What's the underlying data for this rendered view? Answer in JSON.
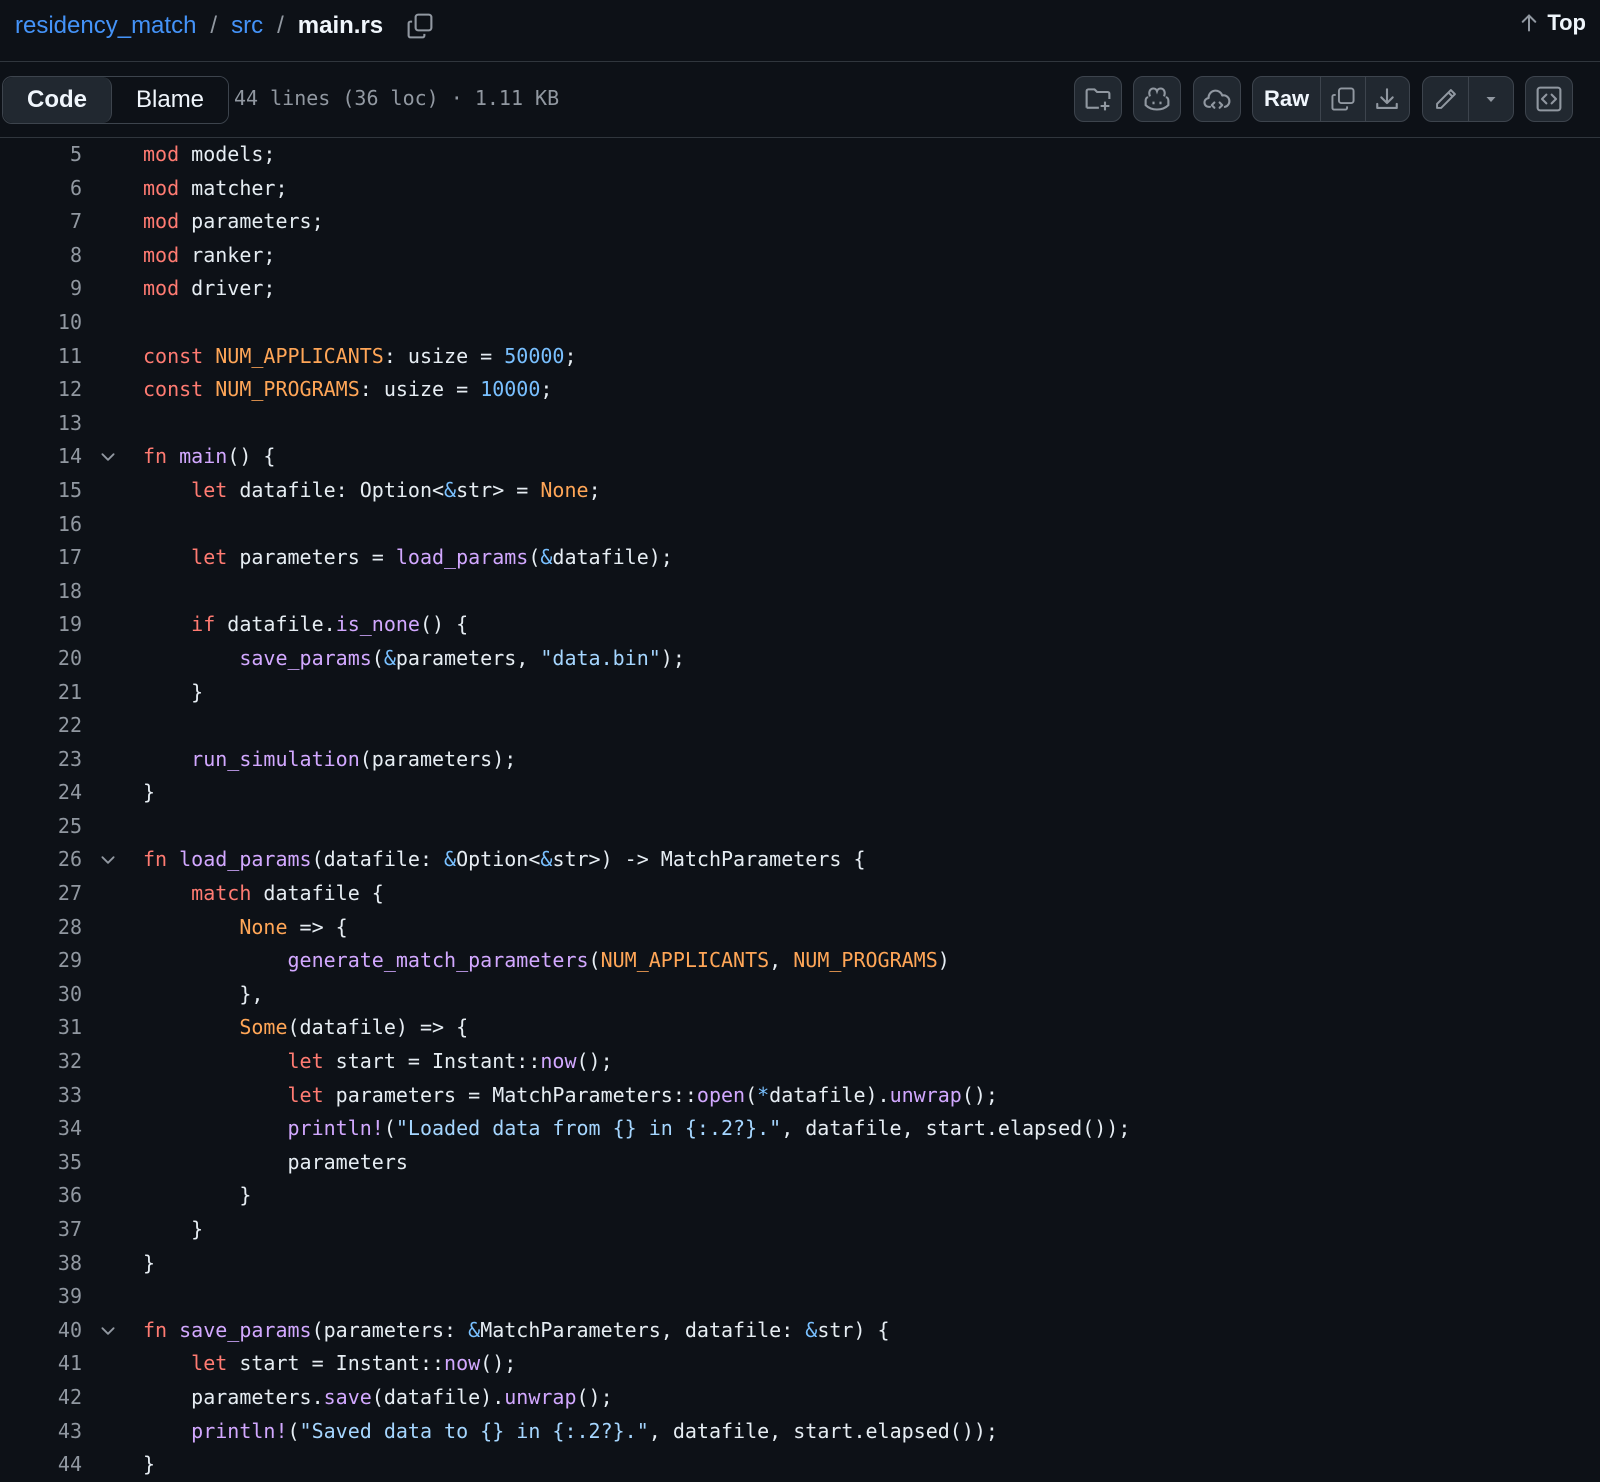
{
  "breadcrumb": {
    "repo": "residency_match",
    "sep1": "/",
    "dir": "src",
    "sep2": "/",
    "file": "main.rs"
  },
  "top_link": "Top",
  "view_tabs": {
    "code": "Code",
    "blame": "Blame"
  },
  "file_info": "44 lines (36 loc) · 1.11 KB",
  "toolbar": {
    "raw_label": "Raw"
  },
  "icons": [
    "copy-path-icon",
    "arrow-up-icon",
    "folder-plus-icon",
    "copilot-icon",
    "codespace-icon",
    "copy-icon",
    "download-icon",
    "pencil-icon",
    "caret-down-icon",
    "symbols-panel-icon",
    "chevron-down-icon"
  ],
  "colors": {
    "background": "#0d1117",
    "keyword": "#ff7b72",
    "function": "#d2a8ff",
    "constant": "#ffa657",
    "number": "#79c0ff",
    "string": "#a5d6ff",
    "link": "#4493f8",
    "line_number": "#9198a1"
  },
  "code_lines": [
    {
      "n": "5",
      "fold": false,
      "tokens": [
        [
          "k",
          "mod"
        ],
        [
          "p",
          " models;"
        ]
      ]
    },
    {
      "n": "6",
      "fold": false,
      "tokens": [
        [
          "k",
          "mod"
        ],
        [
          "p",
          " matcher;"
        ]
      ]
    },
    {
      "n": "7",
      "fold": false,
      "tokens": [
        [
          "k",
          "mod"
        ],
        [
          "p",
          " parameters;"
        ]
      ]
    },
    {
      "n": "8",
      "fold": false,
      "tokens": [
        [
          "k",
          "mod"
        ],
        [
          "p",
          " ranker;"
        ]
      ]
    },
    {
      "n": "9",
      "fold": false,
      "tokens": [
        [
          "k",
          "mod"
        ],
        [
          "p",
          " driver;"
        ]
      ]
    },
    {
      "n": "10",
      "fold": false,
      "tokens": []
    },
    {
      "n": "11",
      "fold": false,
      "tokens": [
        [
          "k",
          "const"
        ],
        [
          "p",
          " "
        ],
        [
          "c",
          "NUM_APPLICANTS"
        ],
        [
          "p",
          ": usize = "
        ],
        [
          "n",
          "50000"
        ],
        [
          "p",
          ";"
        ]
      ]
    },
    {
      "n": "12",
      "fold": false,
      "tokens": [
        [
          "k",
          "const"
        ],
        [
          "p",
          " "
        ],
        [
          "c",
          "NUM_PROGRAMS"
        ],
        [
          "p",
          ": usize = "
        ],
        [
          "n",
          "10000"
        ],
        [
          "p",
          ";"
        ]
      ]
    },
    {
      "n": "13",
      "fold": false,
      "tokens": []
    },
    {
      "n": "14",
      "fold": true,
      "tokens": [
        [
          "k",
          "fn"
        ],
        [
          "p",
          " "
        ],
        [
          "f",
          "main"
        ],
        [
          "p",
          "() {"
        ]
      ]
    },
    {
      "n": "15",
      "fold": false,
      "tokens": [
        [
          "p",
          "    "
        ],
        [
          "k",
          "let"
        ],
        [
          "p",
          " datafile: Option<"
        ],
        [
          "n",
          "&"
        ],
        [
          "p",
          "str> = "
        ],
        [
          "c",
          "None"
        ],
        [
          "p",
          ";"
        ]
      ]
    },
    {
      "n": "16",
      "fold": false,
      "tokens": []
    },
    {
      "n": "17",
      "fold": false,
      "tokens": [
        [
          "p",
          "    "
        ],
        [
          "k",
          "let"
        ],
        [
          "p",
          " parameters = "
        ],
        [
          "f",
          "load_params"
        ],
        [
          "p",
          "("
        ],
        [
          "n",
          "&"
        ],
        [
          "p",
          "datafile);"
        ]
      ]
    },
    {
      "n": "18",
      "fold": false,
      "tokens": []
    },
    {
      "n": "19",
      "fold": false,
      "tokens": [
        [
          "p",
          "    "
        ],
        [
          "k",
          "if"
        ],
        [
          "p",
          " datafile."
        ],
        [
          "f",
          "is_none"
        ],
        [
          "p",
          "() {"
        ]
      ]
    },
    {
      "n": "20",
      "fold": false,
      "tokens": [
        [
          "p",
          "        "
        ],
        [
          "f",
          "save_params"
        ],
        [
          "p",
          "("
        ],
        [
          "n",
          "&"
        ],
        [
          "p",
          "parameters, "
        ],
        [
          "s",
          "\"data.bin\""
        ],
        [
          "p",
          ");"
        ]
      ]
    },
    {
      "n": "21",
      "fold": false,
      "tokens": [
        [
          "p",
          "    }"
        ]
      ]
    },
    {
      "n": "22",
      "fold": false,
      "tokens": []
    },
    {
      "n": "23",
      "fold": false,
      "tokens": [
        [
          "p",
          "    "
        ],
        [
          "f",
          "run_simulation"
        ],
        [
          "p",
          "(parameters);"
        ]
      ]
    },
    {
      "n": "24",
      "fold": false,
      "tokens": [
        [
          "p",
          "}"
        ]
      ]
    },
    {
      "n": "25",
      "fold": false,
      "tokens": []
    },
    {
      "n": "26",
      "fold": true,
      "tokens": [
        [
          "k",
          "fn"
        ],
        [
          "p",
          " "
        ],
        [
          "f",
          "load_params"
        ],
        [
          "p",
          "(datafile: "
        ],
        [
          "n",
          "&"
        ],
        [
          "p",
          "Option<"
        ],
        [
          "n",
          "&"
        ],
        [
          "p",
          "str>) -> MatchParameters {"
        ]
      ]
    },
    {
      "n": "27",
      "fold": false,
      "tokens": [
        [
          "p",
          "    "
        ],
        [
          "k",
          "match"
        ],
        [
          "p",
          " datafile {"
        ]
      ]
    },
    {
      "n": "28",
      "fold": false,
      "tokens": [
        [
          "p",
          "        "
        ],
        [
          "c",
          "None"
        ],
        [
          "p",
          " => {"
        ]
      ]
    },
    {
      "n": "29",
      "fold": false,
      "tokens": [
        [
          "p",
          "            "
        ],
        [
          "f",
          "generate_match_parameters"
        ],
        [
          "p",
          "("
        ],
        [
          "c",
          "NUM_APPLICANTS"
        ],
        [
          "p",
          ", "
        ],
        [
          "c",
          "NUM_PROGRAMS"
        ],
        [
          "p",
          ")"
        ]
      ]
    },
    {
      "n": "30",
      "fold": false,
      "tokens": [
        [
          "p",
          "        },"
        ]
      ]
    },
    {
      "n": "31",
      "fold": false,
      "tokens": [
        [
          "p",
          "        "
        ],
        [
          "c",
          "Some"
        ],
        [
          "p",
          "(datafile) => {"
        ]
      ]
    },
    {
      "n": "32",
      "fold": false,
      "tokens": [
        [
          "p",
          "            "
        ],
        [
          "k",
          "let"
        ],
        [
          "p",
          " start = Instant::"
        ],
        [
          "f",
          "now"
        ],
        [
          "p",
          "();"
        ]
      ]
    },
    {
      "n": "33",
      "fold": false,
      "tokens": [
        [
          "p",
          "            "
        ],
        [
          "k",
          "let"
        ],
        [
          "p",
          " parameters = MatchParameters::"
        ],
        [
          "f",
          "open"
        ],
        [
          "p",
          "("
        ],
        [
          "n",
          "*"
        ],
        [
          "p",
          "datafile)."
        ],
        [
          "f",
          "unwrap"
        ],
        [
          "p",
          "();"
        ]
      ]
    },
    {
      "n": "34",
      "fold": false,
      "tokens": [
        [
          "p",
          "            "
        ],
        [
          "f",
          "println!"
        ],
        [
          "p",
          "("
        ],
        [
          "s",
          "\"Loaded data from {} in {:.2?}.\""
        ],
        [
          "p",
          ", datafile, start.elapsed());"
        ]
      ]
    },
    {
      "n": "35",
      "fold": false,
      "tokens": [
        [
          "p",
          "            parameters"
        ]
      ]
    },
    {
      "n": "36",
      "fold": false,
      "tokens": [
        [
          "p",
          "        }"
        ]
      ]
    },
    {
      "n": "37",
      "fold": false,
      "tokens": [
        [
          "p",
          "    }"
        ]
      ]
    },
    {
      "n": "38",
      "fold": false,
      "tokens": [
        [
          "p",
          "}"
        ]
      ]
    },
    {
      "n": "39",
      "fold": false,
      "tokens": []
    },
    {
      "n": "40",
      "fold": true,
      "tokens": [
        [
          "k",
          "fn"
        ],
        [
          "p",
          " "
        ],
        [
          "f",
          "save_params"
        ],
        [
          "p",
          "(parameters: "
        ],
        [
          "n",
          "&"
        ],
        [
          "p",
          "MatchParameters, datafile: "
        ],
        [
          "n",
          "&"
        ],
        [
          "p",
          "str) {"
        ]
      ]
    },
    {
      "n": "41",
      "fold": false,
      "tokens": [
        [
          "p",
          "    "
        ],
        [
          "k",
          "let"
        ],
        [
          "p",
          " start = Instant::"
        ],
        [
          "f",
          "now"
        ],
        [
          "p",
          "();"
        ]
      ]
    },
    {
      "n": "42",
      "fold": false,
      "tokens": [
        [
          "p",
          "    parameters."
        ],
        [
          "f",
          "save"
        ],
        [
          "p",
          "(datafile)."
        ],
        [
          "f",
          "unwrap"
        ],
        [
          "p",
          "();"
        ]
      ]
    },
    {
      "n": "43",
      "fold": false,
      "tokens": [
        [
          "p",
          "    "
        ],
        [
          "f",
          "println!"
        ],
        [
          "p",
          "("
        ],
        [
          "s",
          "\"Saved data to {} in {:.2?}.\""
        ],
        [
          "p",
          ", datafile, start.elapsed());"
        ]
      ]
    },
    {
      "n": "44",
      "fold": false,
      "tokens": [
        [
          "p",
          "}"
        ]
      ]
    }
  ]
}
